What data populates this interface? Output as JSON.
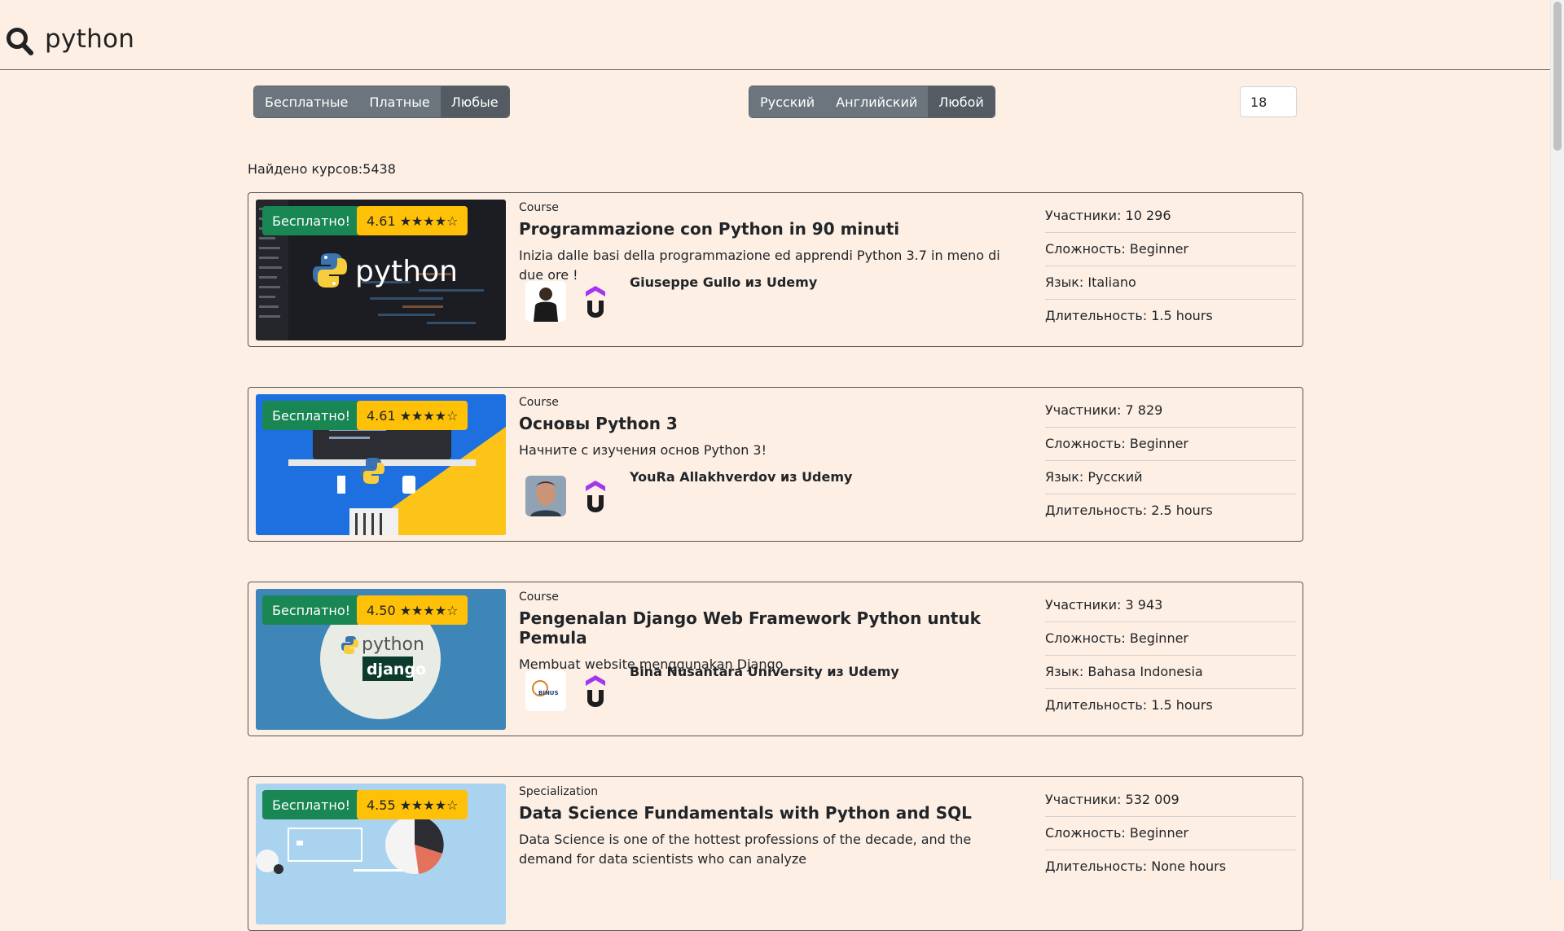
{
  "search": {
    "query": "python",
    "icon": "search-icon"
  },
  "filters": {
    "price": {
      "options": [
        "Бесплатные",
        "Платные",
        "Любые"
      ],
      "selected": "Любые"
    },
    "language": {
      "options": [
        "Русский",
        "Английский",
        "Любой"
      ],
      "selected": "Любой"
    },
    "per_page": "18"
  },
  "found_label": "Найдено курсов:5438",
  "courses": [
    {
      "free_badge": "Бесплатно!",
      "rating": "4.61 ★★★★☆",
      "type": "Course",
      "title": "Programmazione con Python in 90 minuti",
      "description": "Inizia dalle basi della programmazione ed apprendi Python 3.7 in meno di due ore !",
      "author": "Giuseppe Gullo из Udemy",
      "stats": [
        "Участники: 10 296",
        "Сложность: Beginner",
        "Язык: Italiano",
        "Длительность: 1.5 hours"
      ]
    },
    {
      "free_badge": "Бесплатно!",
      "rating": "4.61 ★★★★☆",
      "type": "Course",
      "title": "Основы Python 3",
      "description": "Начните с изучения основ Python 3!",
      "author": "YouRa Allakhverdov из Udemy",
      "stats": [
        "Участники: 7 829",
        "Сложность: Beginner",
        "Язык: Русский",
        "Длительность: 2.5 hours"
      ]
    },
    {
      "free_badge": "Бесплатно!",
      "rating": "4.50 ★★★★☆",
      "type": "Course",
      "title": "Pengenalan Django Web Framework Python untuk Pemula",
      "description": "Membuat website menggunakan Django",
      "author": "Bina Nusantara University из Udemy",
      "stats": [
        "Участники: 3 943",
        "Сложность: Beginner",
        "Язык: Bahasa Indonesia",
        "Длительность: 1.5 hours"
      ]
    },
    {
      "free_badge": "Бесплатно!",
      "rating": "4.55 ★★★★☆",
      "type": "Specialization",
      "title": "Data Science Fundamentals with Python and SQL",
      "description": "Data Science is one of the hottest professions of the decade, and the demand for data scientists who can analyze",
      "author": "",
      "stats": [
        "Участники: 532 009",
        "Сложность: Beginner",
        "Длительность: None hours"
      ]
    }
  ],
  "thumb_text": {
    "python_logo": "python",
    "django_python": "python",
    "django_logo": "django",
    "binus": "BINUS"
  },
  "colors": {
    "background": "#fdefe4",
    "free_badge": "#198754",
    "rating_badge": "#ffc107",
    "button": "#6c757d"
  }
}
